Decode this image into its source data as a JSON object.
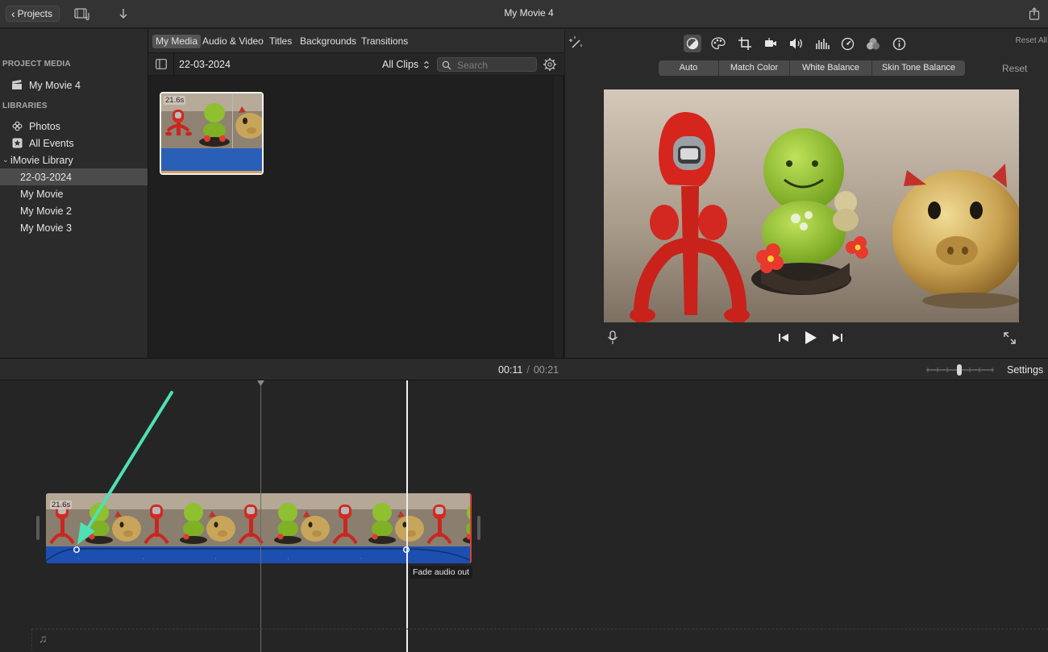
{
  "window": {
    "title": "My Movie 4"
  },
  "toolbar": {
    "projects_label": "Projects",
    "icons": [
      "media-library-icon",
      "import-icon",
      "share-icon"
    ]
  },
  "sidebar": {
    "project_media_header": "PROJECT MEDIA",
    "project_item": "My Movie 4",
    "libraries_header": "LIBRARIES",
    "photos": "Photos",
    "all_events": "All Events",
    "library_name": "iMovie Library",
    "events": [
      "22-03-2024",
      "My Movie",
      "My Movie 2",
      "My Movie 3"
    ],
    "selected_event": "22-03-2024"
  },
  "browser": {
    "tabs": [
      "My Media",
      "Audio & Video",
      "Titles",
      "Backgrounds",
      "Transitions"
    ],
    "active_tab": "My Media",
    "event_title": "22-03-2024",
    "clips_filter": "All Clips",
    "search_placeholder": "Search",
    "clip_duration": "21.6s"
  },
  "viewer": {
    "reset_all": "Reset All",
    "color_options": [
      "Auto",
      "Match Color",
      "White Balance",
      "Skin Tone Balance"
    ],
    "reset": "Reset",
    "tool_icons": [
      "color-balance-icon",
      "color-correction-icon",
      "crop-icon",
      "stabilization-icon",
      "volume-icon",
      "noise-reduction-icon",
      "speed-icon",
      "clip-filter-icon",
      "info-icon"
    ]
  },
  "timeline": {
    "current_time": "00:11",
    "separator": "/",
    "total_time": "00:21",
    "settings": "Settings",
    "clip_duration": "21.6s",
    "tooltip": "Fade audio out"
  },
  "colors": {
    "audio_waveform": "#1d4fb0",
    "annotation_arrow": "#4fe0b5",
    "clip_end_marker": "#d2433b"
  }
}
